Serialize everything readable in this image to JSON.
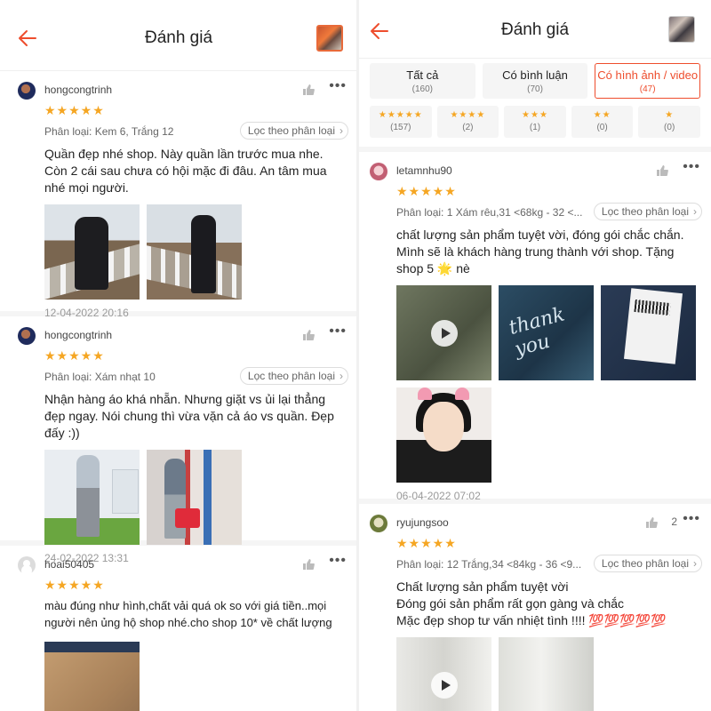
{
  "left": {
    "title": "Đánh giá",
    "reviews": [
      {
        "user": "hongcongtrinh",
        "stars": "★★★★★",
        "variant": "Phân loại: Kem 6, Trắng 12",
        "filter": "Lọc theo phân loại",
        "text": "Quần đẹp nhé shop. Này quần lần trước mua nhe. Còn 2 cái sau chưa có hội mặc đi đâu. An tâm mua nhé mọi người.",
        "date": "12-04-2022 20:16"
      },
      {
        "user": "hongcongtrinh",
        "stars": "★★★★★",
        "variant": "Phân loại: Xám nhạt 10",
        "filter": "Lọc theo phân loại",
        "text": "Nhận hàng áo khá nhẵn. Nhưng giặt vs ủi lại thẳng đẹp ngay. Nói chung thì vừa vặn cả áo vs quần. Đẹp đấy :))",
        "date": "24-02-2022 13:31"
      },
      {
        "user": "hoai50405",
        "stars": "★★★★★",
        "text": "màu đúng như hình,chất vải quá ok so với giá tiền..mọi người nên ủng hộ shop nhé.cho shop 10* về chất lượng"
      }
    ]
  },
  "right": {
    "title": "Đánh giá",
    "tabs": [
      {
        "label": "Tất cả",
        "count": "(160)"
      },
      {
        "label": "Có bình luận",
        "count": "(70)"
      },
      {
        "label": "Có hình ảnh / video",
        "count": "(47)"
      }
    ],
    "star_tabs": [
      {
        "stars": "★★★★★",
        "count": "(157)"
      },
      {
        "stars": "★★★★",
        "count": "(2)"
      },
      {
        "stars": "★★★",
        "count": "(1)"
      },
      {
        "stars": "★★",
        "count": "(0)"
      },
      {
        "stars": "★",
        "count": "(0)"
      }
    ],
    "reviews": [
      {
        "user": "letamnhu90",
        "stars": "★★★★★",
        "variant": "Phân loại: 1 Xám rêu,31 <68kg - 32 <...",
        "filter": "Lọc theo phân loại",
        "text": "chất lượng sản phẩm tuyệt vời, đóng gói chắc chắn. Mình sẽ là khách hàng trung thành với shop. Tặng shop 5 🌟 nè",
        "photo_text": "thank you",
        "date": "06-04-2022 07:02"
      },
      {
        "user": "ryujungsoo",
        "likes": "2",
        "stars": "★★★★★",
        "variant": "Phân loại: 12 Trắng,34 <84kg - 36 <9...",
        "filter": "Lọc theo phân loại",
        "text_lines": [
          "Chất lượng sản phẩm tuyệt vời",
          "Đóng gói sản phẩm rất gọn gàng và chắc",
          "Mặc đẹp shop tư vấn nhiệt tình !!!! 💯💯💯💯💯"
        ]
      }
    ]
  },
  "colors": {
    "accent": "#ee4d2d",
    "star": "#f5a623"
  },
  "icons": {
    "back": "back-arrow-icon",
    "like": "thumbs-up-icon",
    "more": "more-dots-icon",
    "play": "play-icon"
  }
}
